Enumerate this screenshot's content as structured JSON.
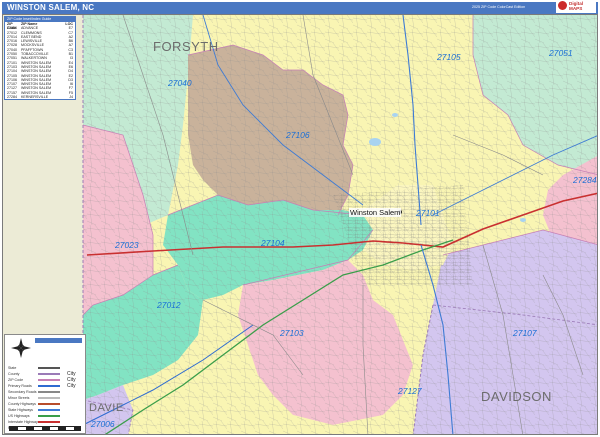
{
  "title": {
    "text": "WINSTON SALEM, NC",
    "edition": "2025 ZIP Code ColorCast Edition"
  },
  "logo": {
    "line1": "Digital",
    "line2": "MAPS"
  },
  "zip_table": {
    "caption": "ZIP Code Inset/Index Guide",
    "headers": [
      "ZIP Code",
      "ZIP Name",
      "LOC"
    ],
    "rows": [
      [
        "27006",
        "ADVANCE",
        "E7"
      ],
      [
        "27012",
        "CLEMMONS",
        "C7"
      ],
      [
        "27014",
        "EAST BEND",
        "A2"
      ],
      [
        "27016",
        "LEWISVILLE",
        "B6"
      ],
      [
        "27028",
        "MOCKSVILLE",
        "A7"
      ],
      [
        "27040",
        "PFAFFTOWN",
        "C3"
      ],
      [
        "27050",
        "TOBACCOVILLE",
        "B1"
      ],
      [
        "27051",
        "WALKERTOWN",
        "I3"
      ],
      [
        "27101",
        "WINSTON SALEM",
        "E4"
      ],
      [
        "27103",
        "WINSTON SALEM",
        "E6"
      ],
      [
        "27104",
        "WINSTON SALEM",
        "D4"
      ],
      [
        "27105",
        "WINSTON SALEM",
        "E2"
      ],
      [
        "27106",
        "WINSTON SALEM",
        "D3"
      ],
      [
        "27107",
        "WINSTON SALEM",
        "I6"
      ],
      [
        "27127",
        "WINSTON SALEM",
        "F7"
      ],
      [
        "27157",
        "WINSTON SALEM",
        "F5"
      ],
      [
        "27284",
        "KERNERSVILLE",
        "J4"
      ]
    ]
  },
  "counties": {
    "forsyth": "FORSYTH",
    "davidson": "DAVIDSON",
    "davie": "DAVIE"
  },
  "zips": {
    "z27105": "27105",
    "z27051": "27051",
    "z27040": "27040",
    "z27106": "27106",
    "z27284": "27284",
    "z27101": "27101",
    "z27104": "27104",
    "z27023": "27023",
    "z27012": "27012",
    "z27103": "27103",
    "z27107": "27107",
    "z27127": "27127",
    "z27006": "27006"
  },
  "city_label": "Winston Salem",
  "legend": {
    "rows": [
      {
        "label": "State",
        "color": "#555555"
      },
      {
        "label": "County",
        "color": "#9b7bb7"
      },
      {
        "label": "ZIP Code",
        "color": "#c67fb5"
      },
      {
        "label": "Primary Roads",
        "color": "#2e6bd1"
      },
      {
        "label": "Secondary Roads",
        "color": "#888888"
      },
      {
        "label": "Minor Streets",
        "color": "#bbbbbb"
      },
      {
        "label": "County Highways",
        "color": "#b84d2b"
      },
      {
        "label": "State Highways",
        "color": "#3e7bd4"
      },
      {
        "label": "US Highways",
        "color": "#3a9e4a"
      },
      {
        "label": "Interstate Highways",
        "color": "#c93030"
      },
      {
        "label": "Railroads",
        "color": "#444444"
      }
    ],
    "cities": [
      "City",
      "City",
      "City"
    ]
  },
  "zone_colors": {
    "yellow": "#f9f5b3",
    "brown": "#c9b29b",
    "green": "#c3ead3",
    "teal": "#82e3c3",
    "pink": "#f4c1cf",
    "purple": "#d3c6ef",
    "water": "#a9d3f0"
  }
}
